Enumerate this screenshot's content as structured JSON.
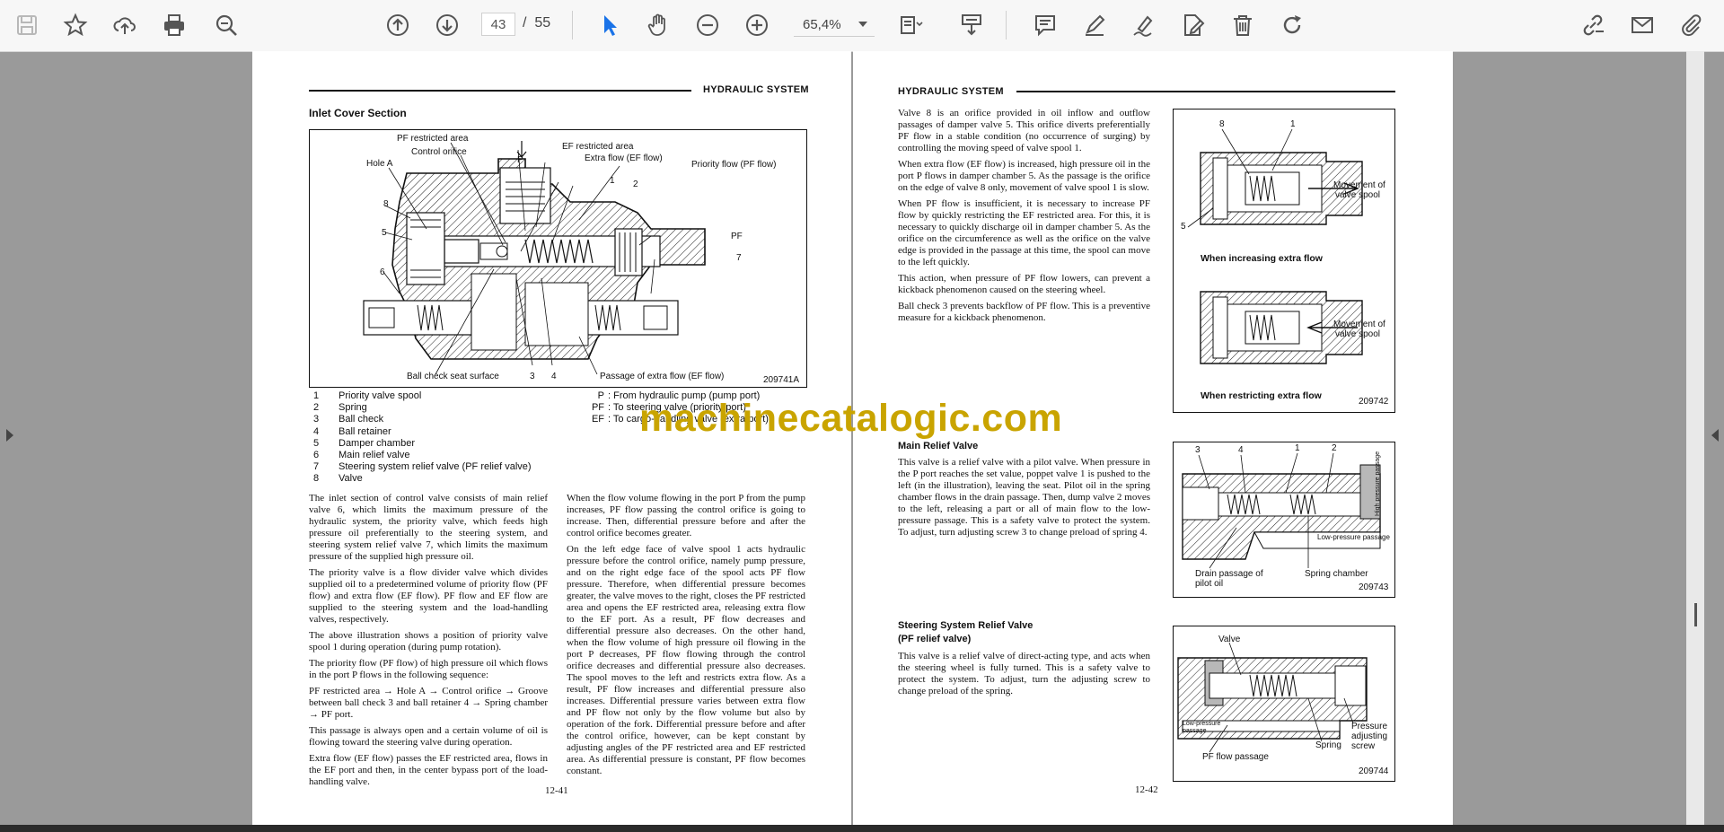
{
  "toolbar": {
    "page_current": "43",
    "page_separator": "/",
    "page_total": "55",
    "zoom": "65,4%",
    "icons": [
      "save-icon",
      "bookmark-star-icon",
      "upload-cloud-icon",
      "print-icon",
      "zoom-search-icon",
      "page-up-icon",
      "page-down-icon",
      "select-cursor-icon",
      "hand-tool-icon",
      "zoom-out-icon",
      "zoom-in-icon",
      "fit-page-icon",
      "scroll-mode-icon",
      "comment-icon",
      "highlight-pen-icon",
      "sign-icon",
      "edit-document-icon",
      "delete-icon",
      "rotate-icon",
      "link-icon",
      "email-icon",
      "attachment-icon"
    ]
  },
  "watermark": "machinecatalogic.com",
  "left_page": {
    "header": "HYDRAULIC SYSTEM",
    "section_title": "Inlet Cover Section",
    "figure": {
      "number": "209741A",
      "labels": {
        "pf_restricted": "PF restricted area",
        "control_orifice": "Control orifice",
        "ef_restricted": "EF restricted area",
        "extra_flow": "Extra flow (EF flow)",
        "hole_a": "Hole A",
        "priority_flow": "Priority flow (PF flow)",
        "p": "P",
        "pf": "PF",
        "n1": "1",
        "n2": "2",
        "n3": "3",
        "n4": "4",
        "n5": "5",
        "n6": "6",
        "n7": "7",
        "n8": "8",
        "ball_check_seat": "Ball check seat surface",
        "passage_extra": "Passage of extra flow (EF flow)"
      }
    },
    "parts": [
      {
        "n": "1",
        "name": "Priority valve spool"
      },
      {
        "n": "2",
        "name": "Spring"
      },
      {
        "n": "3",
        "name": "Ball check"
      },
      {
        "n": "4",
        "name": "Ball retainer"
      },
      {
        "n": "5",
        "name": "Damper chamber"
      },
      {
        "n": "6",
        "name": "Main relief valve"
      },
      {
        "n": "7",
        "name": "Steering system relief valve (PF relief valve)"
      },
      {
        "n": "8",
        "name": "Valve"
      }
    ],
    "ports": [
      {
        "k": "P",
        "v": ": From hydraulic pump (pump port)"
      },
      {
        "k": "PF",
        "v": ": To steering valve (priority port)"
      },
      {
        "k": "EF",
        "v": ": To cargo-handling valve (extra port)"
      }
    ],
    "col1": [
      "The inlet section of control valve consists of main relief valve 6, which limits the maximum pressure of the hydraulic system, the priority valve, which feeds high pressure oil preferentially to the steering system, and steering system relief valve 7, which limits the maximum pressure of the supplied high pressure oil.",
      "The priority valve is a flow divider valve which divides supplied oil to a predetermined volume of priority flow (PF flow) and extra flow (EF flow).  PF flow and EF flow are supplied to the steering system and the load-handling valves, respectively.",
      "The above illustration shows a position of priority valve spool 1 during operation (during pump rotation).",
      "The priority flow (PF flow) of high pressure oil which flows in the port P flows in the following sequence:",
      "PF restricted area → Hole A → Control orifice → Groove between ball check 3 and ball retainer 4 → Spring chamber → PF port.",
      "This passage is always open and a certain volume of oil is flowing toward the steering valve during operation.",
      "Extra flow (EF flow) passes the EF restricted area, flows in the EF port and then, in the center bypass port of the load-handling valve."
    ],
    "col2": [
      "When the flow volume flowing in the port P from the pump increases, PF flow passing the control orifice is going to increase.  Then, differential pressure before and after the control orifice becomes greater.",
      "On the left edge face of valve spool 1 acts hydraulic pressure before the control orifice, namely pump pressure, and on the right edge face of the spool acts PF flow pressure.  Therefore, when differential pressure becomes greater, the valve moves to the right, closes the PF restricted area and opens the EF restricted area, releasing extra flow to the EF port.  As a result, PF flow decreases and differential pressure also decreases.  On the other hand, when the flow volume of high pressure oil flowing in the port P decreases, PF flow flowing through the control orifice decreases and differential pressure also decreases.  The spool moves to the left and restricts extra flow.  As a result, PF flow increases and differential pressure also increases.  Differential pressure varies between extra flow and PF flow not only by the flow volume but also by operation of the fork.  Differential pressure before and after the control orifice, however, can be kept constant by adjusting angles of the PF restricted area and EF restricted area.  As differential pressure is constant, PF flow becomes constant."
    ],
    "page_number": "12-41"
  },
  "right_page": {
    "header": "HYDRAULIC SYSTEM",
    "intro": [
      "Valve 8 is an orifice provided in oil inflow and outflow passages of damper valve 5.  This orifice diverts preferentially PF flow in a stable condition (no occurrence of surging) by controlling the moving speed of valve spool 1.",
      "When extra flow (EF flow) is increased, high pressure oil in the port P flows in damper chamber 5.  As the passage is the orifice on the edge of valve 8 only, movement of valve spool 1 is slow.",
      "When PF flow is insufficient, it is necessary to increase PF flow by quickly restricting the EF restricted area.  For this, it is necessary to quickly discharge oil in damper chamber 5.  As the orifice on the circumference as well as the orifice on the valve edge is provided in the passage at this time, the spool can move to the left quickly.",
      "This action, when pressure of PF flow lowers, can prevent a kickback phenomenon caused on the steering wheel.",
      "Ball check 3 prevents backflow of PF flow.  This is a preventive measure for a kickback phenomenon."
    ],
    "fig742": {
      "number": "209742",
      "top_caption": "When increasing extra flow",
      "bottom_caption": "When restricting extra flow",
      "label_8": "8",
      "label_1": "1",
      "label_5": "5",
      "movement_top": "Movement of",
      "movement_top2": "valve spool",
      "movement_bottom": "Movement of",
      "movement_bottom2": "valve spool"
    },
    "main_relief": {
      "title": "Main Relief Valve",
      "text": "This valve is a relief valve with a pilot valve.  When pressure in the P port reaches the set value, poppet valve 1 is pushed to the left (in the illustration), leaving the seat.  Pilot oil in the spring chamber flows in the drain passage.  Then, dump valve 2 moves to the left, releasing a part or all of main flow to the low-pressure passage.  This is a safety valve to protect the system.  To adjust, turn adjusting screw 3 to change preload of spring 4."
    },
    "fig743": {
      "number": "209743",
      "l3": "3",
      "l4": "4",
      "l1": "1",
      "l2": "2",
      "high_pressure": "High pressure passage",
      "low_pressure": "Low-pressure passage",
      "drain": "Drain passage of",
      "drain2": "pilot oil",
      "spring_chamber": "Spring chamber"
    },
    "steering_relief": {
      "title": "Steering System Relief Valve",
      "title2": "(PF relief valve)",
      "text": "This valve is a relief valve of direct-acting type, and acts when the steering wheel is fully turned.  This is a safety valve to protect the system.  To adjust, turn the adjusting screw to change preload of the spring."
    },
    "fig744": {
      "number": "209744",
      "valve": "Valve",
      "low_pressure": "Low-pressure",
      "low_pressure2": "passage",
      "pressure_adj": "Pressure",
      "pressure_adj2": "adjusting",
      "pressure_adj3": "screw",
      "spring": "Spring",
      "pf_passage": "PF flow passage"
    },
    "page_number": "12-42"
  }
}
